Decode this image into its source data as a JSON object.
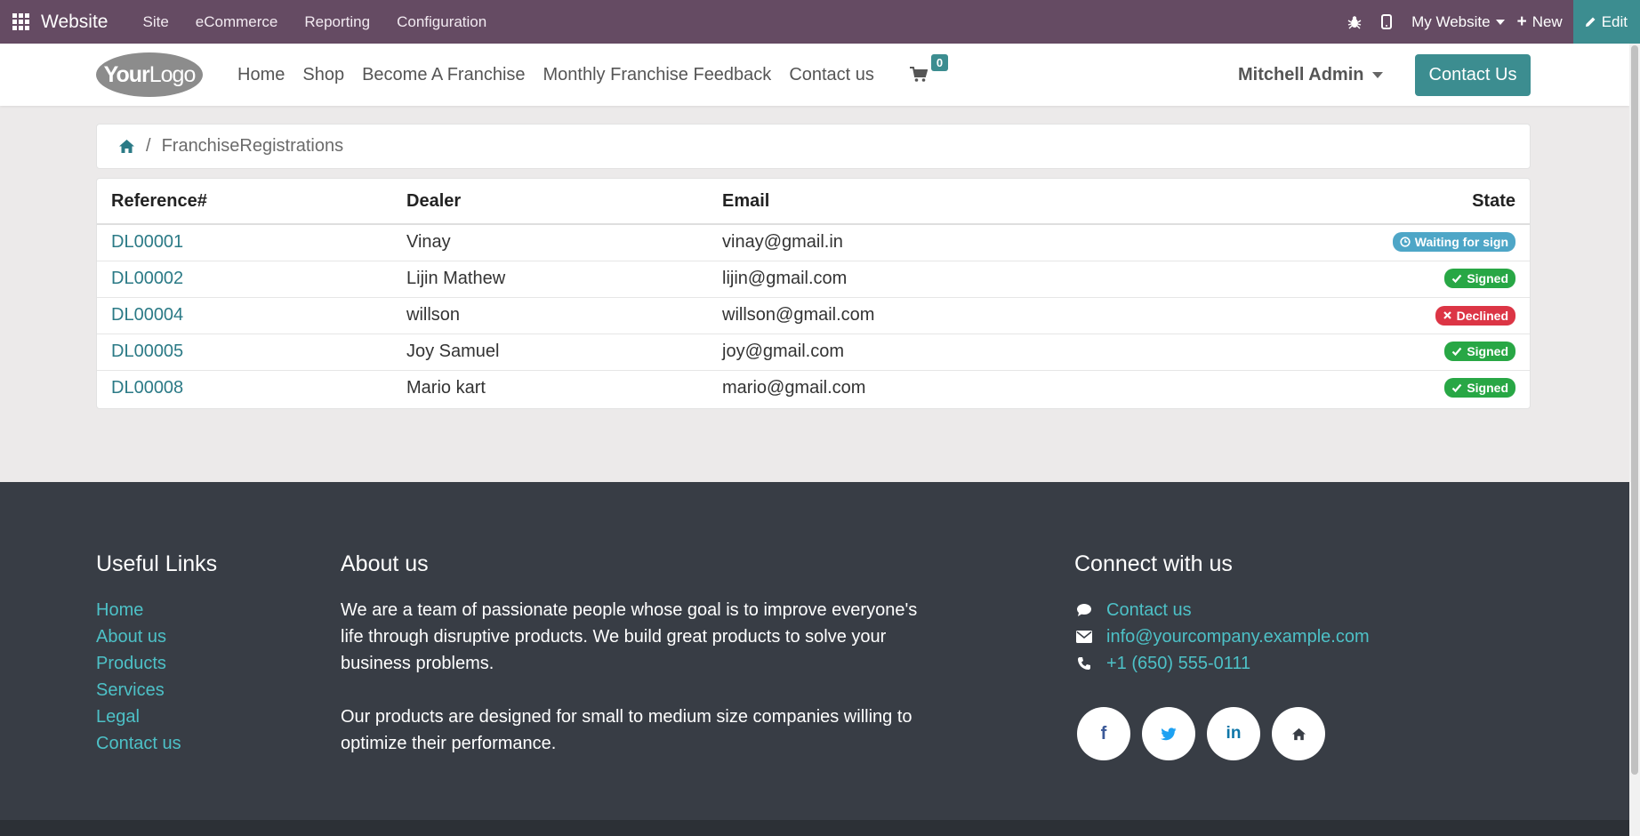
{
  "adminbar": {
    "app_name": "Website",
    "menu": [
      "Site",
      "eCommerce",
      "Reporting",
      "Configuration"
    ],
    "website_selector": "My Website",
    "new_label": "New",
    "edit_label": "Edit"
  },
  "header": {
    "logo_text_bold": "Your",
    "logo_text_thin": "Logo",
    "nav": [
      "Home",
      "Shop",
      "Become A Franchise",
      "Monthly Franchise Feedback",
      "Contact us"
    ],
    "cart_count": "0",
    "user_name": "Mitchell Admin",
    "contact_button": "Contact Us"
  },
  "breadcrumb": {
    "current": "FranchiseRegistrations"
  },
  "table": {
    "headers": [
      "Reference#",
      "Dealer",
      "Email",
      "State"
    ],
    "rows": [
      {
        "ref": "DL00001",
        "dealer": "Vinay",
        "email": "vinay@gmail.in",
        "state": "Waiting for sign",
        "status": "info"
      },
      {
        "ref": "DL00002",
        "dealer": "Lijin Mathew",
        "email": "lijin@gmail.com",
        "state": "Signed",
        "status": "success"
      },
      {
        "ref": "DL00004",
        "dealer": "willson",
        "email": "willson@gmail.com",
        "state": "Declined",
        "status": "danger"
      },
      {
        "ref": "DL00005",
        "dealer": "Joy Samuel",
        "email": "joy@gmail.com",
        "state": "Signed",
        "status": "success"
      },
      {
        "ref": "DL00008",
        "dealer": "Mario kart",
        "email": "mario@gmail.com",
        "state": "Signed",
        "status": "success"
      }
    ]
  },
  "footer": {
    "useful_links": {
      "title": "Useful Links",
      "links": [
        "Home",
        "About us",
        "Products",
        "Services",
        "Legal",
        "Contact us"
      ]
    },
    "about": {
      "title": "About us",
      "p1": "We are a team of passionate people whose goal is to improve everyone's life through disruptive products. We build great products to solve your business problems.",
      "p2": "Our products are designed for small to medium size companies willing to optimize their performance."
    },
    "connect": {
      "title": "Connect with us",
      "contact": "Contact us",
      "email": "info@yourcompany.example.com",
      "phone": "+1 (650) 555-0111",
      "socials": [
        "facebook-icon",
        "twitter-icon",
        "linkedin-icon",
        "home-icon"
      ]
    }
  },
  "colors": {
    "adminbar": "#654b63",
    "accent": "#3c8d90",
    "link": "#2b7a86",
    "footer_bg": "#383d45",
    "footer_link": "#4dc1c7",
    "info": "#4ea6c7",
    "success": "#28a745",
    "danger": "#dc3545"
  }
}
